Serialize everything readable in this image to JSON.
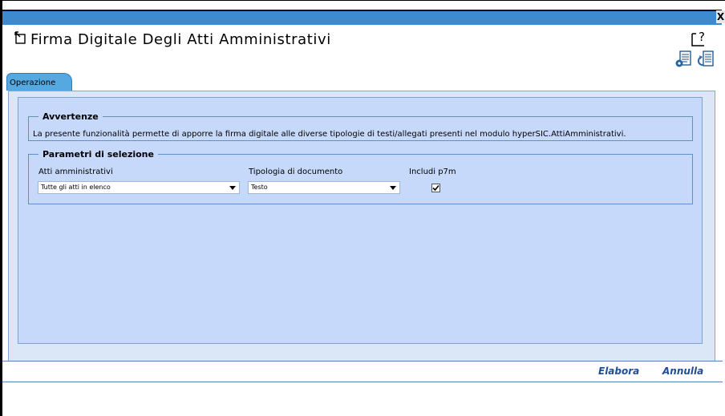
{
  "window": {
    "close_glyph": "X",
    "title": "Firma Digitale Degli Atti Amministrativi"
  },
  "icons": {
    "title_icon": "export-icon",
    "help": "help-icon",
    "tool_1": "settings-document-icon",
    "tool_2": "refresh-document-icon"
  },
  "tabs": [
    {
      "label": "Operazione",
      "active": true
    }
  ],
  "warnings": {
    "legend": "Avvertenze",
    "text": "La presente funzionalità permette di apporre la firma digitale alle diverse tipologie di testi/allegati presenti nel modulo hyperSIC.AttiAmministrativi."
  },
  "selection": {
    "legend": "Parametri di selezione",
    "atti_label": "Atti amministrativi",
    "atti_value": "Tutte gli atti in elenco",
    "tipologia_label": "Tipologia di documento",
    "tipologia_value": "Testo",
    "p7m_label": "Includi p7m",
    "p7m_checked": true
  },
  "actions": {
    "elabora": "Elabora",
    "annulla": "Annulla"
  },
  "colors": {
    "title_bar": "#3d8ad1",
    "panel_bg": "#c6d9fa",
    "link": "#1f4d96",
    "tab": "#55a8e0"
  }
}
